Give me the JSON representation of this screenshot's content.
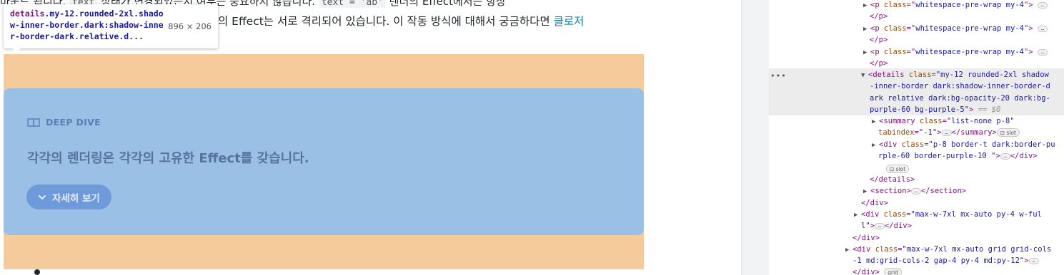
{
  "page": {
    "top_line_prefix": "마운트 됩니다. ",
    "top_line_code1": "text",
    "top_line_mid": " 상태가 변경되었는지 여부는 중요하지 않습니다. ",
    "top_line_code2": "text = 'ab'",
    "top_line_suffix": " 렌더의 Effect에서는 항상",
    "body_line_text": "의 Effect는 서로 격리되어 있습니다. 이 작동 방식에 대해서 궁금하다면 ",
    "body_line_link": "클로저"
  },
  "tooltip": {
    "selector_tag": "details",
    "selector_classes": ".my-12.rounded-2xl.shadow-inner-border.dark:shadow-inner-border-dark.relative.d...",
    "size": "896 × 206"
  },
  "deep_dive": {
    "label": "DEEP DIVE",
    "icon": "book-open-icon",
    "title": "각각의 렌더링은 각각의 고유한 Effect를 갖습니다.",
    "button_label": "자세히 보기",
    "button_icon": "chevron-down-icon"
  },
  "colors": {
    "margin_highlight": "#f6cb9b",
    "content_highlight": "#9bc0e6",
    "button": "#6e99db",
    "link": "#087ea4"
  },
  "devtools": {
    "p_rows": [
      {
        "tag": "p",
        "attr": "class",
        "value": "whitespace-pre-wrap my-4",
        "close": "</p>"
      },
      {
        "tag": "p",
        "attr": "class",
        "value": "whitespace-pre-wrap my-4",
        "close": "</p>"
      },
      {
        "tag": "p",
        "attr": "class",
        "value": "whitespace-pre-wrap my-4",
        "close": "</p>"
      }
    ],
    "selected": {
      "open": "<details ",
      "attr": "class",
      "value_lines": [
        "\"my-12 rounded-2xl shadow",
        "-inner-border dark:shadow-inner-border-d",
        "ark relative dark:bg-opacity-20 dark:bg-",
        "purple-60 bg-purple-5\""
      ],
      "end": ">",
      "marker": "== $0"
    },
    "summary": {
      "open": "<summary ",
      "attr1": "class",
      "val1": "\"list-none p-8\"",
      "attr2": "tabindex",
      "val2": "\"-1\"",
      "close": "</summary>",
      "badge": "slot"
    },
    "div_p8": {
      "open": "<div ",
      "attr": "class",
      "val_line1": "\"p-8 border-t dark:border-pu",
      "val_line2": "rple-60 border-purple-10 \"",
      "close": "</div>",
      "badge": "slot"
    },
    "details_close": "</details>",
    "section": {
      "open": "<section>",
      "close": "</section>"
    },
    "div_close1": "</div>",
    "div_maxw": {
      "open": "<div ",
      "attr": "class",
      "val_line1": "\"max-w-7xl mx-auto py-4 w-ful",
      "val_line2": "l\"",
      "close": "</div>"
    },
    "div_close2": "</div>",
    "div_grid": {
      "open": "<div ",
      "attr": "class",
      "val_line1": "\"max-w-7xl mx-auto grid grid-cols",
      "val_line2": "-1 md:grid-cols-2 gap-4 py-4 md:py-12\"",
      "close": "</div>",
      "badge": "grid"
    }
  }
}
